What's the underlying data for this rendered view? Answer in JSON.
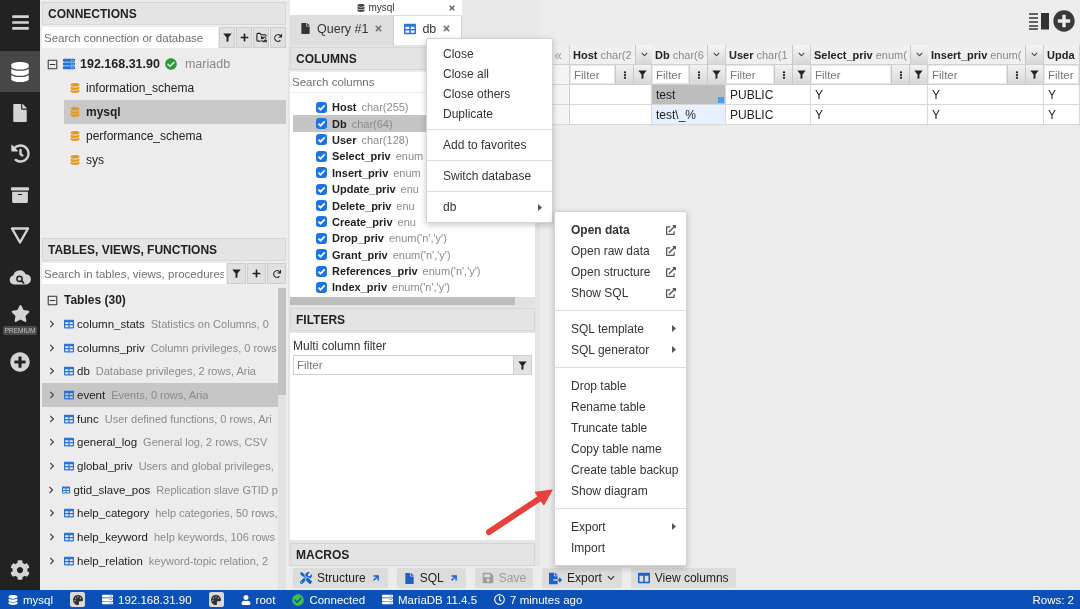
{
  "rail": {
    "items": [
      {
        "selected": false
      },
      {
        "selected": true
      },
      {
        "selected": false
      },
      {
        "selected": false
      },
      {
        "selected": false
      },
      {
        "selected": false
      },
      {
        "selected": false
      },
      {
        "selected": false,
        "badge": "PREMIUM"
      },
      {
        "selected": false
      }
    ],
    "footer": [
      {
        "selected": false
      }
    ]
  },
  "connections": {
    "title": "CONNECTIONS",
    "search": {
      "placeholder": "Search connection or database"
    },
    "server": {
      "name": "192.168.31.90",
      "connected": true,
      "engine": "mariadb",
      "expanded": true,
      "databases": [
        {
          "name": "information_schema",
          "selected": false
        },
        {
          "name": "mysql",
          "selected": true
        },
        {
          "name": "performance_schema",
          "selected": false
        },
        {
          "name": "sys",
          "selected": false
        }
      ]
    }
  },
  "objects": {
    "title": "TABLES, VIEWS, FUNCTIONS",
    "search": {
      "placeholder": "Search in tables, views, procedures"
    },
    "group": {
      "label": "Tables (30)",
      "expanded": true,
      "items": [
        {
          "name": "column_stats",
          "description": "Statistics on Columns, 0",
          "selected": false,
          "expanded": false
        },
        {
          "name": "columns_priv",
          "description": "Column privileges, 0 rows",
          "selected": false,
          "expanded": false
        },
        {
          "name": "db",
          "description": "Database privileges, 2 rows, Aria",
          "selected": false,
          "expanded": false
        },
        {
          "name": "event",
          "description": "Events, 0 rows, Aria",
          "selected": true,
          "expanded": false
        },
        {
          "name": "func",
          "description": "User defined functions, 0 rows, Ari",
          "selected": false,
          "expanded": false
        },
        {
          "name": "general_log",
          "description": "General log, 2 rows, CSV",
          "selected": false,
          "expanded": false
        },
        {
          "name": "global_priv",
          "description": "Users and global privileges,",
          "selected": false,
          "expanded": false
        },
        {
          "name": "gtid_slave_pos",
          "description": "Replication slave GTID p",
          "selected": false,
          "expanded": false
        },
        {
          "name": "help_category",
          "description": "help categories, 50 rows,",
          "selected": false,
          "expanded": false
        },
        {
          "name": "help_keyword",
          "description": "help keywords, 106 rows",
          "selected": false,
          "expanded": false
        },
        {
          "name": "help_relation",
          "description": "keyword-topic relation, 2",
          "selected": false,
          "expanded": false
        }
      ]
    }
  },
  "editor": {
    "title": "mysql",
    "tabs": [
      {
        "label": "Query #1",
        "kind": "query",
        "selected": false
      },
      {
        "label": "db",
        "kind": "table",
        "selected": true
      }
    ]
  },
  "columns_panel": {
    "title": "COLUMNS",
    "search": {
      "placeholder": "Search columns"
    },
    "columns": [
      {
        "name": "Host",
        "type": "char(255)",
        "checked": true,
        "selected": false
      },
      {
        "name": "Db",
        "type": "char(64)",
        "checked": true,
        "selected": true
      },
      {
        "name": "User",
        "type": "char(128)",
        "checked": true,
        "selected": false
      },
      {
        "name": "Select_priv",
        "type": "enum",
        "checked": true,
        "selected": false
      },
      {
        "name": "Insert_priv",
        "type": "enum",
        "checked": true,
        "selected": false
      },
      {
        "name": "Update_priv",
        "type": "enu",
        "checked": true,
        "selected": false
      },
      {
        "name": "Delete_priv",
        "type": "enu",
        "checked": true,
        "selected": false
      },
      {
        "name": "Create_priv",
        "type": "enu",
        "checked": true,
        "selected": false
      },
      {
        "name": "Drop_priv",
        "type": "enum('n','y')",
        "checked": true,
        "selected": false
      },
      {
        "name": "Grant_priv",
        "type": "enum('n','y')",
        "checked": true,
        "selected": false
      },
      {
        "name": "References_priv",
        "type": "enum('n','y')",
        "checked": true,
        "selected": false
      },
      {
        "name": "Index_priv",
        "type": "enum('n','y')",
        "checked": true,
        "selected": false
      }
    ]
  },
  "filters_panel": {
    "title": "FILTERS",
    "label": "Multi column filter",
    "input": {
      "placeholder": "Filter"
    }
  },
  "macros_panel": {
    "title": "MACROS"
  },
  "grid": {
    "collapse_glyph": "«",
    "columns": [
      {
        "name": "Host",
        "type": "char(2",
        "filter_placeholder": "Filter",
        "truncated": false
      },
      {
        "name": "Db",
        "type": "char(6",
        "filter_placeholder": "Filter",
        "truncated": false
      },
      {
        "name": "User",
        "type": "char(1",
        "filter_placeholder": "Filter",
        "truncated": false
      },
      {
        "name": "Select_priv",
        "type": "enum(",
        "filter_placeholder": "Filter",
        "truncated": false
      },
      {
        "name": "Insert_priv",
        "type": "enum(",
        "filter_placeholder": "Filter",
        "truncated": false
      },
      {
        "name": "Upda",
        "filter_placeholder": "Filter",
        "truncated": true
      }
    ],
    "rows": [
      {
        "cells": [
          {
            "selected": false,
            "highlighted": false
          },
          {
            "text": "test",
            "selected": true,
            "highlighted": false
          },
          {
            "text": "PUBLIC",
            "selected": false,
            "highlighted": false
          },
          {
            "text": "Y",
            "selected": false,
            "highlighted": false
          },
          {
            "text": "Y",
            "selected": false,
            "highlighted": false
          },
          {
            "text": "Y",
            "selected": false,
            "highlighted": false
          }
        ]
      },
      {
        "cells": [
          {
            "selected": false,
            "highlighted": false
          },
          {
            "text": "test\\_%",
            "selected": false,
            "highlighted": true
          },
          {
            "text": "PUBLIC",
            "selected": false,
            "highlighted": false
          },
          {
            "text": "Y",
            "selected": false,
            "highlighted": false
          },
          {
            "text": "Y",
            "selected": false,
            "highlighted": false
          },
          {
            "text": "Y",
            "selected": false,
            "highlighted": false
          }
        ]
      }
    ]
  },
  "toolbar": {
    "buttons": [
      {
        "label": "Structure",
        "kind": "structure",
        "disabled": false
      },
      {
        "label": "SQL",
        "kind": "sql",
        "disabled": false
      },
      {
        "label": "Save",
        "kind": "save",
        "disabled": true
      },
      {
        "label": "Export",
        "kind": "export",
        "disabled": false
      },
      {
        "label": "View columns",
        "kind": "columns",
        "disabled": false
      }
    ]
  },
  "status_bar": {
    "items": [
      {
        "kind": "database",
        "text": "mysql"
      },
      {
        "kind": "theme"
      },
      {
        "kind": "server",
        "text": "192.168.31.90"
      },
      {
        "kind": "theme"
      },
      {
        "kind": "user",
        "text": "root"
      },
      {
        "kind": "status",
        "text": "Connected"
      },
      {
        "kind": "engine",
        "text": "MariaDB 11.4.5"
      },
      {
        "kind": "time",
        "text": "7 minutes ago"
      }
    ],
    "rows": "Rows: 2"
  },
  "tab_menu": {
    "groups": [
      {
        "items": [
          {
            "label": "Close",
            "kind": "plain"
          },
          {
            "label": "Close all",
            "kind": "plain"
          },
          {
            "label": "Close others",
            "kind": "plain"
          },
          {
            "label": "Duplicate",
            "kind": "plain"
          }
        ]
      },
      {
        "items": [
          {
            "label": "Add to favorites",
            "kind": "plain"
          }
        ]
      },
      {
        "items": [
          {
            "label": "Switch database",
            "kind": "plain"
          }
        ]
      },
      {
        "items": [
          {
            "label": "db",
            "kind": "submenu"
          }
        ]
      }
    ]
  },
  "table_menu": {
    "groups": [
      {
        "items": [
          {
            "label": "Open data",
            "kind": "external",
            "default": true
          },
          {
            "label": "Open raw data",
            "kind": "external",
            "default": false
          },
          {
            "label": "Open structure",
            "kind": "external",
            "default": false
          },
          {
            "label": "Show SQL",
            "kind": "external",
            "default": false
          }
        ]
      },
      {
        "items": [
          {
            "label": "SQL template",
            "kind": "submenu",
            "default": false
          },
          {
            "label": "SQL generator",
            "kind": "submenu",
            "default": false
          }
        ]
      },
      {
        "items": [
          {
            "label": "Drop table",
            "kind": "plain",
            "default": false
          },
          {
            "label": "Rename table",
            "kind": "plain",
            "default": false
          },
          {
            "label": "Truncate table",
            "kind": "plain",
            "default": false
          },
          {
            "label": "Copy table name",
            "kind": "plain",
            "default": false
          },
          {
            "label": "Create table backup",
            "kind": "plain",
            "default": false
          },
          {
            "label": "Show diagram",
            "kind": "plain",
            "default": false
          }
        ]
      },
      {
        "items": [
          {
            "label": "Export",
            "kind": "submenu",
            "default": false
          },
          {
            "label": "Import",
            "kind": "plain",
            "default": false
          }
        ]
      }
    ]
  }
}
